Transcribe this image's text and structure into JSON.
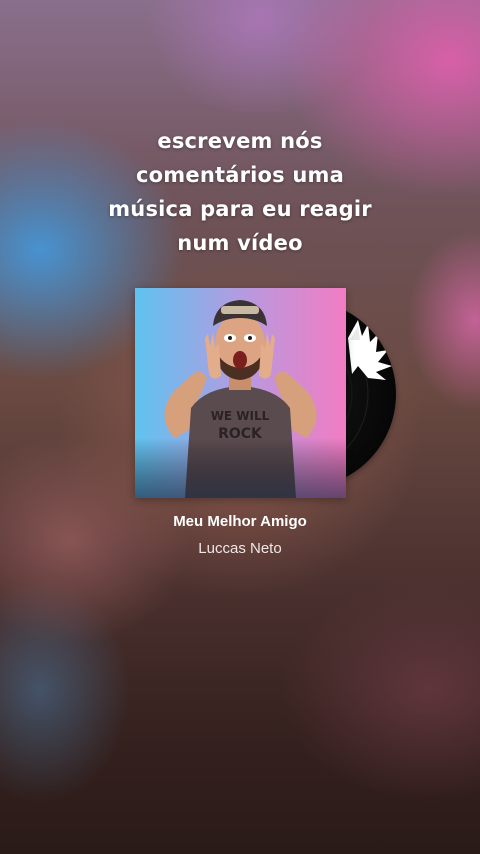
{
  "caption": {
    "lines": [
      "escrevem nós",
      "comentários uma",
      "música para eu reagir",
      "num vídeo"
    ]
  },
  "music": {
    "title": "Meu Melhor Amigo",
    "artist": "Luccas Neto",
    "cover_shirt_text": [
      "WE WILL",
      "ROCK"
    ]
  },
  "colors": {
    "cover_blue": "#5fc3f0",
    "cover_pink": "#f27cc3",
    "record_black": "#0b0b0b",
    "text_white": "#ffffff"
  }
}
